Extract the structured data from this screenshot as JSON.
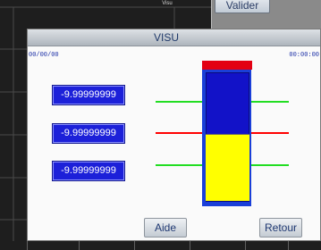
{
  "app": {
    "title_small": "Visu"
  },
  "back_dialog": {
    "confirm_label": "Valider"
  },
  "window": {
    "title": "VISU",
    "date": "00/00/00",
    "time": "00:00:00"
  },
  "values": [
    {
      "label": "-9.99999999"
    },
    {
      "label": "-9.99999999"
    },
    {
      "label": "-9.99999999"
    }
  ],
  "gauge": {
    "level_fraction": 0.52,
    "colors": {
      "frame": "#1a3fd8",
      "fill": "#ffff00",
      "cap": "#e30012"
    }
  },
  "indicator_lines": [
    {
      "color": "#22dd22"
    },
    {
      "color": "#ff0000"
    },
    {
      "color": "#22dd22"
    }
  ],
  "buttons": {
    "help_label": "Aide",
    "back_label": "Retour"
  }
}
